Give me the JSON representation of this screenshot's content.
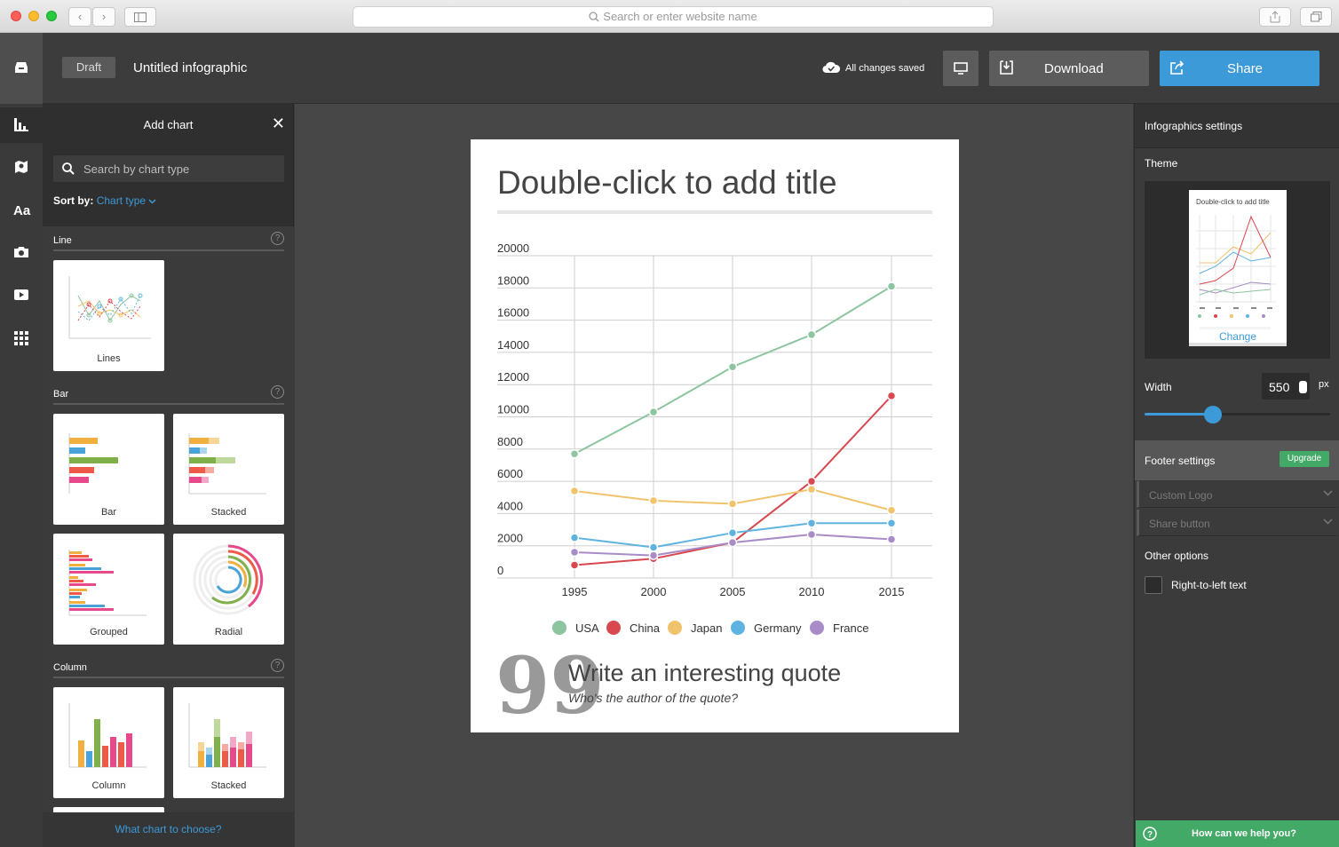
{
  "browser": {
    "url_placeholder": "Search or enter website name"
  },
  "header": {
    "draft_label": "Draft",
    "doc_title": "Untitled infographic",
    "save_status": "All changes saved",
    "download_label": "Download",
    "share_label": "Share"
  },
  "chart_panel": {
    "title": "Add chart",
    "close_glyph": "✕",
    "search_placeholder": "Search by chart type",
    "sort_label": "Sort by:",
    "sort_value": "Chart type",
    "sections": [
      {
        "label": "Line",
        "items": [
          "Lines"
        ]
      },
      {
        "label": "Bar",
        "items": [
          "Bar",
          "Stacked",
          "Grouped",
          "Radial"
        ]
      },
      {
        "label": "Column",
        "items": [
          "Column",
          "Stacked"
        ]
      }
    ],
    "help_glyph": "?",
    "footer_link": "What chart to choose?"
  },
  "page": {
    "title": "Double-click to add title",
    "quote_glyph": "99",
    "quote_text": "Write an interesting quote",
    "quote_author": "Who's the author of the quote?"
  },
  "chart_data": {
    "type": "line",
    "x": [
      1995,
      2000,
      2005,
      2010,
      2015
    ],
    "ylim": [
      0,
      20000
    ],
    "yticks": [
      0,
      2000,
      4000,
      6000,
      8000,
      10000,
      12000,
      14000,
      16000,
      18000,
      20000
    ],
    "grid": true,
    "legend": "bottom",
    "series": [
      {
        "name": "USA",
        "color": "#8cc5a0",
        "values": [
          7700,
          10300,
          13100,
          15100,
          18100
        ]
      },
      {
        "name": "China",
        "color": "#d9484f",
        "values": [
          800,
          1200,
          2200,
          6000,
          11300
        ]
      },
      {
        "name": "Japan",
        "color": "#f0c36c",
        "values": [
          5400,
          4800,
          4600,
          5500,
          4200
        ]
      },
      {
        "name": "Germany",
        "color": "#5eb3e0",
        "values": [
          2500,
          1900,
          2800,
          3400,
          3400
        ]
      },
      {
        "name": "France",
        "color": "#a98bc7",
        "values": [
          1600,
          1400,
          2200,
          2700,
          2400
        ]
      }
    ]
  },
  "settings": {
    "header": "Infographics settings",
    "theme_label": "Theme",
    "theme_preview_title": "Double-click to add title",
    "theme_change": "Change",
    "width_label": "Width",
    "width_value": "550",
    "width_unit": "px",
    "width_slider_fraction": 0.37,
    "footer_label": "Footer settings",
    "upgrade_label": "Upgrade",
    "custom_logo": "Custom Logo",
    "share_button": "Share button",
    "other_options": "Other options",
    "rtl_label": "Right-to-left text",
    "help_text": "How can we help you?"
  },
  "colors": {
    "accent": "#3d9ad9",
    "success": "#43a966"
  }
}
